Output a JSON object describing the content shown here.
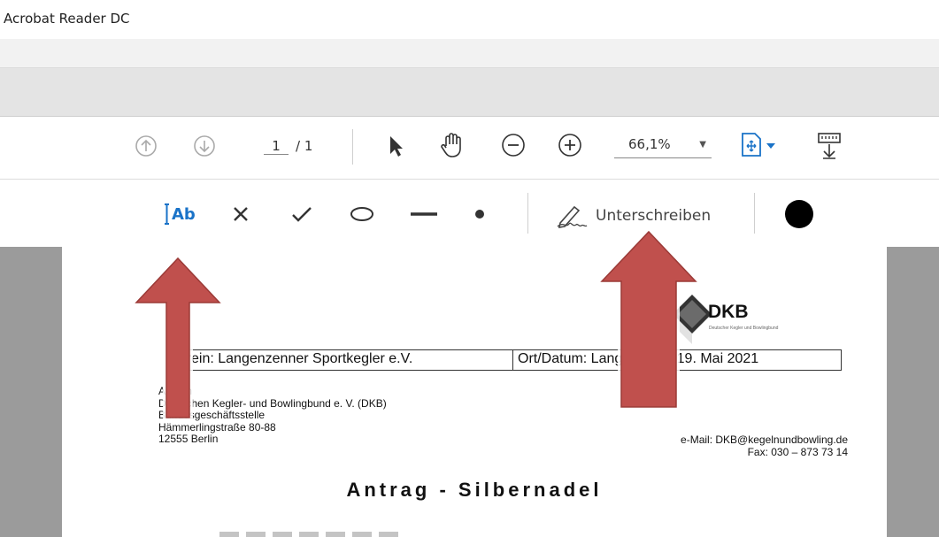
{
  "window": {
    "title": "Acrobat Reader DC"
  },
  "toolbar": {
    "page_current": "1",
    "page_total": "/ 1",
    "zoom": "66,1%"
  },
  "fill_sign": {
    "sign_label": "Unterschreiben",
    "color": "#000000"
  },
  "document": {
    "verein": "Verein: Langenzenner Sportkegler e.V.",
    "ort_datum": "Ort/Datum: Langenzenn, 19. Mai 2021",
    "address_lines": [
      "An den",
      "Deutschen Kegler- und Bowlingbund e. V. (DKB)",
      "Bundesgeschäftsstelle",
      "Hämmerlingstraße 80-88",
      "12555 Berlin"
    ],
    "email": "e-Mail: DKB@kegelnundbowling.de",
    "fax": "Fax: 030 – 873 73 14",
    "heading": "Antrag - Silbernadel",
    "logo_text": "DKB",
    "logo_subtitle": "Deutscher Kegler und Bowlingbund"
  },
  "colors": {
    "arrow": "#c0504d",
    "page_bg": "#9b9b9b"
  }
}
